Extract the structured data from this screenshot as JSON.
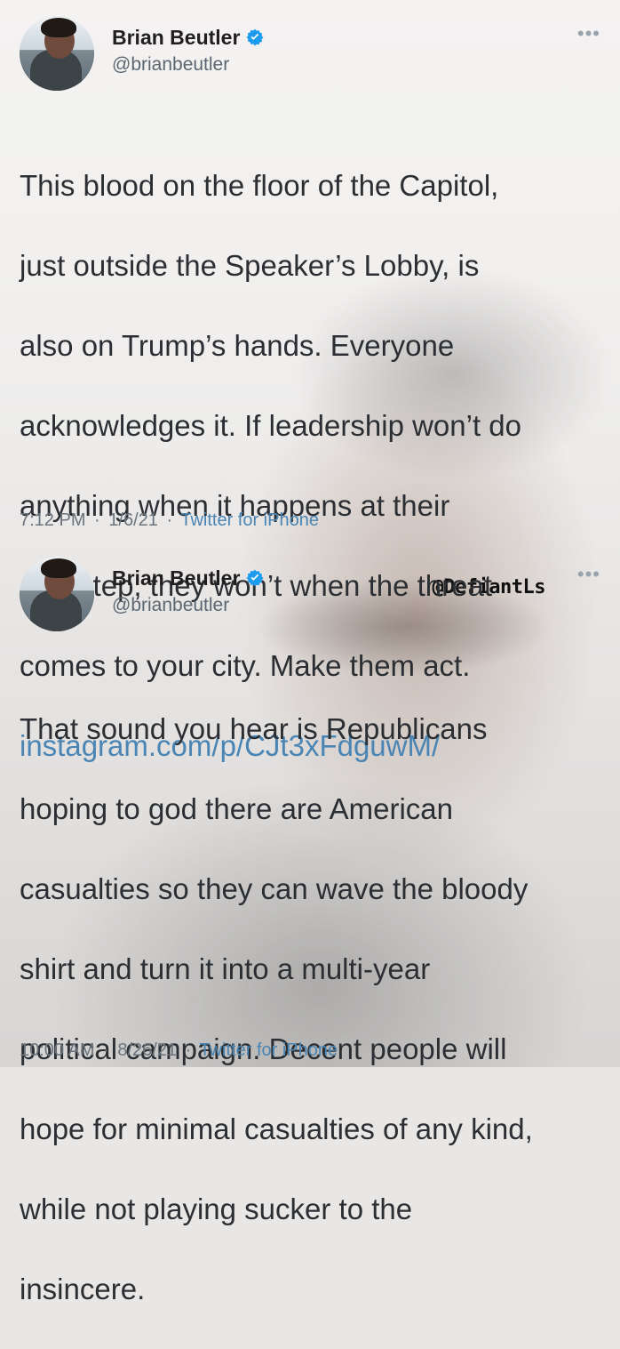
{
  "overlay_watermark": "@DefiantLs",
  "tweets": [
    {
      "author_name": "Brian Beutler",
      "handle": "@brianbeutler",
      "more_icon": "more-options-icon",
      "text_lines": [
        "This blood on the floor of the Capitol,",
        "just outside the Speaker’s Lobby, is",
        "also on Trump’s hands. Everyone",
        "acknowledges it. If leadership won’t do",
        "anything when it happens at their",
        "doorstep, they won’t when the threat",
        "comes to your city. Make them act."
      ],
      "link": "instagram.com/p/CJt3xFdguwM/",
      "time": "7:12 PM",
      "date": "1/6/21",
      "source": "Twitter for iPhone"
    },
    {
      "author_name": "Brian Beutler",
      "handle": "@brianbeutler",
      "more_icon": "more-options-icon",
      "text_lines": [
        "That sound you hear is Republicans",
        "hoping to god there are American",
        "casualties so they can wave the bloody",
        "shirt and turn it into a multi-year",
        "political campaign. Decent people will",
        "hope for minimal casualties of any kind,",
        "while not playing sucker to the",
        "insincere."
      ],
      "time": "10:00 AM",
      "date": "8/26/21",
      "source": "Twitter for iPhone"
    }
  ],
  "colors": {
    "link": "#4a85b4",
    "verified": "#1d9bf0",
    "text": "#2b2f33",
    "meta": "#6b747c"
  }
}
